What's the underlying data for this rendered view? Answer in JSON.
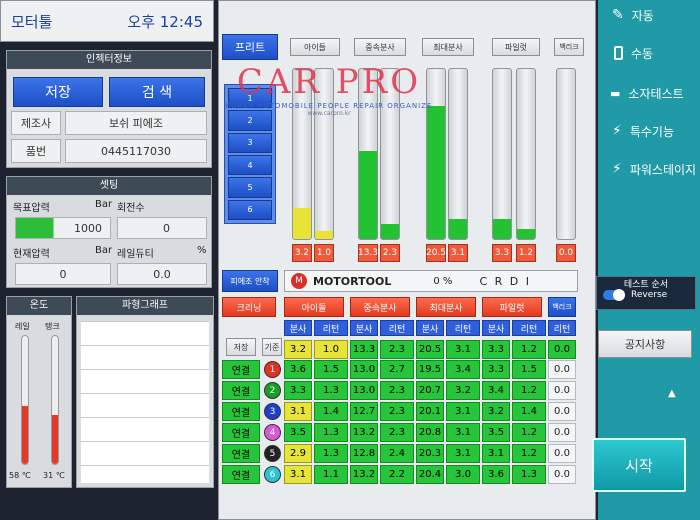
{
  "status": {
    "title": "모터툴",
    "time": "오후 12:45"
  },
  "injector_info": {
    "header": "인젝터정보",
    "save_label": "저장",
    "search_label": "검 색",
    "maker_label": "제조사",
    "maker_value": "보쉬 피에조",
    "part_label": "품번",
    "part_value": "0445117030"
  },
  "settings": {
    "header": "셋팅",
    "target_pressure_label": "목표압력",
    "target_pressure_unit": "Bar",
    "target_pressure_value": "1000",
    "rotation_label": "회전수",
    "rotation_value": "0",
    "current_pressure_label": "현재압력",
    "current_pressure_unit": "Bar",
    "current_pressure_value": "0",
    "rail_duty_label": "레일듀티",
    "rail_duty_unit": "%",
    "rail_duty_value": "0.0"
  },
  "temperature": {
    "header": "온도",
    "rail_label": "레일",
    "tank_label": "탱크",
    "rail_value": "58 ℃",
    "tank_value": "31 ℃",
    "rail_level": 0.45,
    "tank_level": 0.38
  },
  "waveform": {
    "header": "파형그래프"
  },
  "watermark": {
    "brand": "CAR PRO",
    "tagline": "KOREA AUTOMOBILE PEOPLE REPAIR ORGANIZE",
    "url": "www.carpro.kr"
  },
  "mode_tabs": [
    "프리트",
    "아이들",
    "중속분사",
    "최대분사",
    "파일럿",
    "백리크"
  ],
  "injector_numbers": [
    "1",
    "2",
    "3",
    "4",
    "5",
    "6"
  ],
  "bars": [
    {
      "name": "idle-spray",
      "value": "3.2",
      "level": 0.18,
      "color": "#e8e437"
    },
    {
      "name": "idle-return",
      "value": "1.0",
      "level": 0.05,
      "color": "#e8e437"
    },
    {
      "name": "mid-spray",
      "value": "13.3",
      "level": 0.52,
      "color": "#22c233"
    },
    {
      "name": "mid-return",
      "value": "2.3",
      "level": 0.09,
      "color": "#22c233"
    },
    {
      "name": "max-spray",
      "value": "20.5",
      "level": 0.78,
      "color": "#22c233"
    },
    {
      "name": "max-return",
      "value": "3.1",
      "level": 0.12,
      "color": "#22c233"
    },
    {
      "name": "pilot-spray",
      "value": "3.3",
      "level": 0.12,
      "color": "#22c233"
    },
    {
      "name": "pilot-return",
      "value": "1.2",
      "level": 0.06,
      "color": "#22c233"
    },
    {
      "name": "backleak",
      "value": "0.0",
      "level": 0.0,
      "color": "#22c233"
    }
  ],
  "control": {
    "piezo_label": "피에조 안착",
    "brand": "MOTORTOOL",
    "percent": "0 %",
    "mode": "C R D I"
  },
  "table": {
    "modes": [
      "크리닝",
      "아이들",
      "중속분사",
      "최대분사",
      "파일럿",
      "백리크"
    ],
    "sub_spray": "분사",
    "sub_return": "리턴",
    "store_label": "저장",
    "base_label": "기준",
    "rows": [
      {
        "status": "연결",
        "num": "1",
        "color": "#e2321f",
        "vals": [
          "3.6",
          "1.5",
          "13.0",
          "2.7",
          "19.5",
          "3.4",
          "3.3",
          "1.5"
        ],
        "y": [
          0,
          0,
          0,
          0,
          0,
          0,
          0,
          0
        ],
        "leak": "0.0"
      },
      {
        "status": "연결",
        "num": "2",
        "color": "#1a9e26",
        "vals": [
          "3.3",
          "1.3",
          "13.0",
          "2.3",
          "20.7",
          "3.2",
          "3.4",
          "1.2"
        ],
        "y": [
          0,
          0,
          0,
          0,
          0,
          0,
          0,
          0
        ],
        "leak": "0.0"
      },
      {
        "status": "연결",
        "num": "3",
        "color": "#2040c8",
        "vals": [
          "3.1",
          "1.4",
          "12.7",
          "2.3",
          "20.1",
          "3.1",
          "3.2",
          "1.4"
        ],
        "y": [
          1,
          0,
          0,
          0,
          0,
          0,
          0,
          0
        ],
        "leak": "0.0"
      },
      {
        "status": "연결",
        "num": "4",
        "color": "#d85ad8",
        "vals": [
          "3.5",
          "1.3",
          "13.2",
          "2.3",
          "20.8",
          "3.1",
          "3.5",
          "1.2"
        ],
        "y": [
          0,
          0,
          0,
          0,
          0,
          0,
          0,
          0
        ],
        "leak": "0.0"
      },
      {
        "status": "연결",
        "num": "5",
        "color": "#222222",
        "vals": [
          "2.9",
          "1.3",
          "12.8",
          "2.4",
          "20.3",
          "3.1",
          "3.1",
          "1.2"
        ],
        "y": [
          1,
          0,
          0,
          0,
          0,
          0,
          0,
          0
        ],
        "leak": "0.0"
      },
      {
        "status": "연결",
        "num": "6",
        "color": "#2bc3d6",
        "vals": [
          "3.1",
          "1.1",
          "13.2",
          "2.2",
          "20.4",
          "3.0",
          "3.6",
          "1.3"
        ],
        "y": [
          1,
          0,
          0,
          0,
          0,
          0,
          0,
          0
        ],
        "leak": "0.0"
      },
      {
        "status": "",
        "num": "",
        "color": "",
        "vals": [
          "3.2",
          "1.0",
          "13.3",
          "2.3",
          "20.5",
          "3.1",
          "3.3",
          "1.2"
        ],
        "y": [
          1,
          1,
          0,
          0,
          0,
          0,
          0,
          0
        ],
        "leak": "0.0"
      }
    ]
  },
  "sidebar": {
    "items": [
      {
        "label": "자동",
        "icon": "pen-icon"
      },
      {
        "label": "수동",
        "icon": "battery-icon"
      },
      {
        "label": "소자테스트",
        "icon": "injector-icon"
      },
      {
        "label": "특수기능",
        "icon": "lightning-icon"
      },
      {
        "label": "파워스테이지",
        "icon": "lightning-icon"
      }
    ],
    "test_order_label": "테스트 순서",
    "test_order_value": "Reverse",
    "notice_label": "공지사항",
    "start_label": "시작"
  }
}
